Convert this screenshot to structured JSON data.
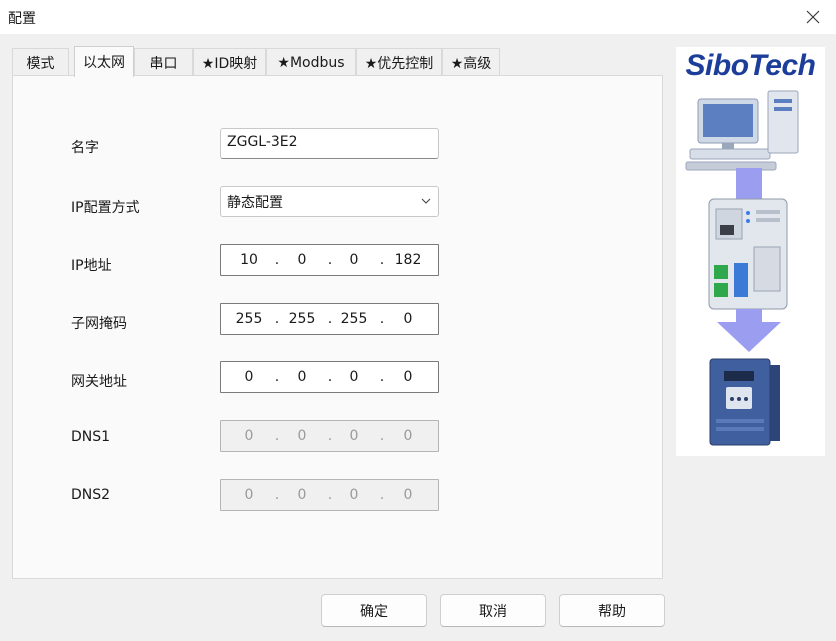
{
  "window": {
    "title": "配置"
  },
  "tabs": [
    {
      "label": "模式"
    },
    {
      "label": "以太网",
      "active": true
    },
    {
      "label": "串口"
    },
    {
      "label": "★ID映射"
    },
    {
      "label": "★Modbus"
    },
    {
      "label": "★优先控制"
    },
    {
      "label": "★高级"
    }
  ],
  "form": {
    "name": {
      "label": "名字",
      "value": "ZGGL-3E2"
    },
    "ip_mode": {
      "label": "IP配置方式",
      "value": "静态配置"
    },
    "ip_address": {
      "label": "IP地址",
      "octets": [
        "10",
        "0",
        "0",
        "182"
      ]
    },
    "subnet_mask": {
      "label": "子网掩码",
      "octets": [
        "255",
        "255",
        "255",
        "0"
      ]
    },
    "gateway": {
      "label": "网关地址",
      "octets": [
        "0",
        "0",
        "0",
        "0"
      ]
    },
    "dns1": {
      "label": "DNS1",
      "octets": [
        "0",
        "0",
        "0",
        "0"
      ],
      "disabled": true
    },
    "dns2": {
      "label": "DNS2",
      "octets": [
        "0",
        "0",
        "0",
        "0"
      ],
      "disabled": true
    }
  },
  "buttons": {
    "ok": "确定",
    "cancel": "取消",
    "help": "帮助"
  },
  "brand": {
    "logo_text": "SiboTech",
    "color": "#1c3e9a"
  },
  "icons": {
    "close": "close-icon",
    "dropdown": "chevron-down-icon",
    "illustration": [
      "computer-icon",
      "gateway-device-icon",
      "frequency-converter-icon"
    ]
  }
}
